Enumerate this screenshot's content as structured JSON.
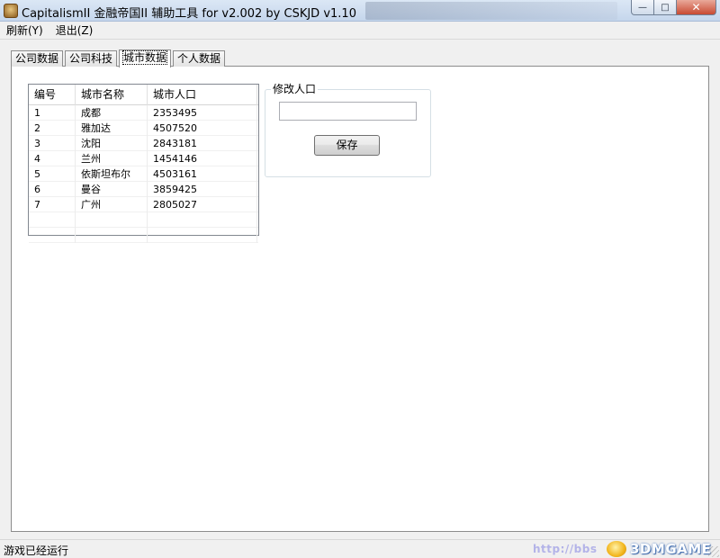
{
  "window": {
    "title": "CapitalismII 金融帝国II 辅助工具 for v2.002 by CSKJD v1.10",
    "buttons": {
      "minimize": "—",
      "maximize": "□",
      "close": "✕"
    }
  },
  "menu": {
    "items": [
      {
        "label": "刷新(Y)"
      },
      {
        "label": "退出(Z)"
      }
    ]
  },
  "tabs": [
    {
      "label": "公司数据",
      "active": false
    },
    {
      "label": "公司科技",
      "active": false
    },
    {
      "label": "城市数据",
      "active": true
    },
    {
      "label": "个人数据",
      "active": false
    }
  ],
  "city_list": {
    "columns": [
      "编号",
      "城市名称",
      "城市人口"
    ],
    "rows": [
      [
        "1",
        "成都",
        "2353495"
      ],
      [
        "2",
        "雅加达",
        "4507520"
      ],
      [
        "3",
        "沈阳",
        "2843181"
      ],
      [
        "4",
        "兰州",
        "1454146"
      ],
      [
        "5",
        "依斯坦布尔",
        "4503161"
      ],
      [
        "6",
        "曼谷",
        "3859425"
      ],
      [
        "7",
        "广州",
        "2805027"
      ],
      [
        "",
        "",
        ""
      ],
      [
        "",
        "",
        ""
      ]
    ]
  },
  "edit_population": {
    "legend": "修改人口",
    "value": "",
    "save_label": "保存"
  },
  "status": {
    "text": "游戏已经运行"
  },
  "watermark": {
    "url": "http://bbs",
    "brand": "3DMGAME"
  }
}
